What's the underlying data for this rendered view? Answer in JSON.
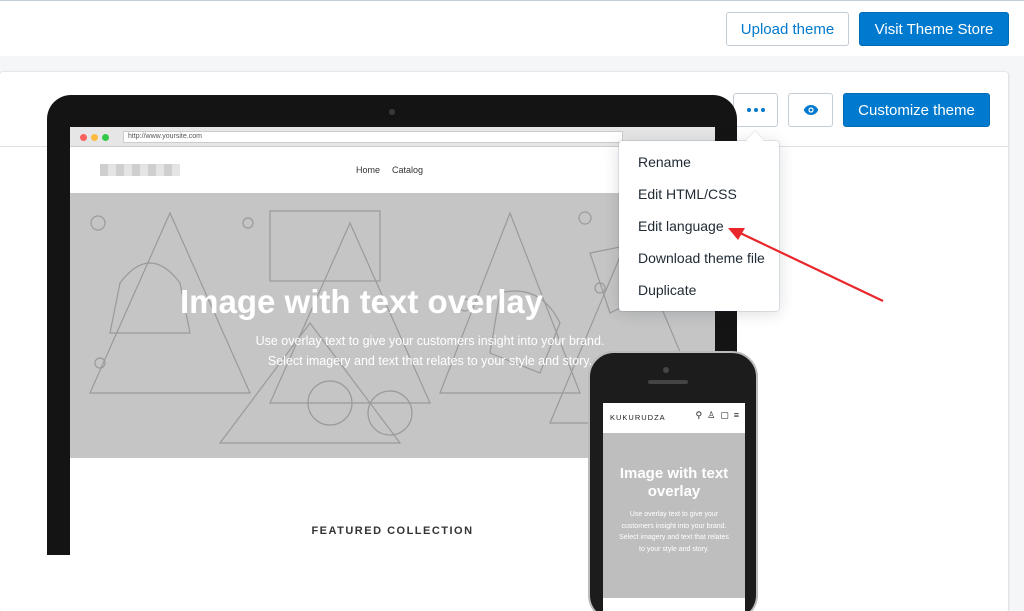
{
  "header": {
    "upload_label": "Upload theme",
    "store_label": "Visit Theme Store"
  },
  "theme_card": {
    "more_actions_icon": "ellipsis-icon",
    "preview_icon": "eye-icon",
    "customize_label": "Customize theme"
  },
  "menu": {
    "items": [
      {
        "label": "Rename"
      },
      {
        "label": "Edit HTML/CSS"
      },
      {
        "label": "Edit language"
      },
      {
        "label": "Download theme file"
      },
      {
        "label": "Duplicate"
      }
    ]
  },
  "preview": {
    "url": "http://www.yoursite.com",
    "nav": [
      "Home",
      "Catalog"
    ],
    "hero_title": "Image with text overlay",
    "hero_sub_1": "Use overlay text to give your customers insight into your brand.",
    "hero_sub_2": "Select imagery and text that relates to your style and story.",
    "featured": "FEATURED COLLECTION",
    "mobile_brand": "KUKURUDZA",
    "mobile_title": "Image with text overlay",
    "mobile_sub": "Use overlay text to give your customers insight into your brand. Select imagery and text that relates to your style and story."
  },
  "colors": {
    "accent": "#007ace",
    "annotation_arrow": "#e8262b"
  }
}
